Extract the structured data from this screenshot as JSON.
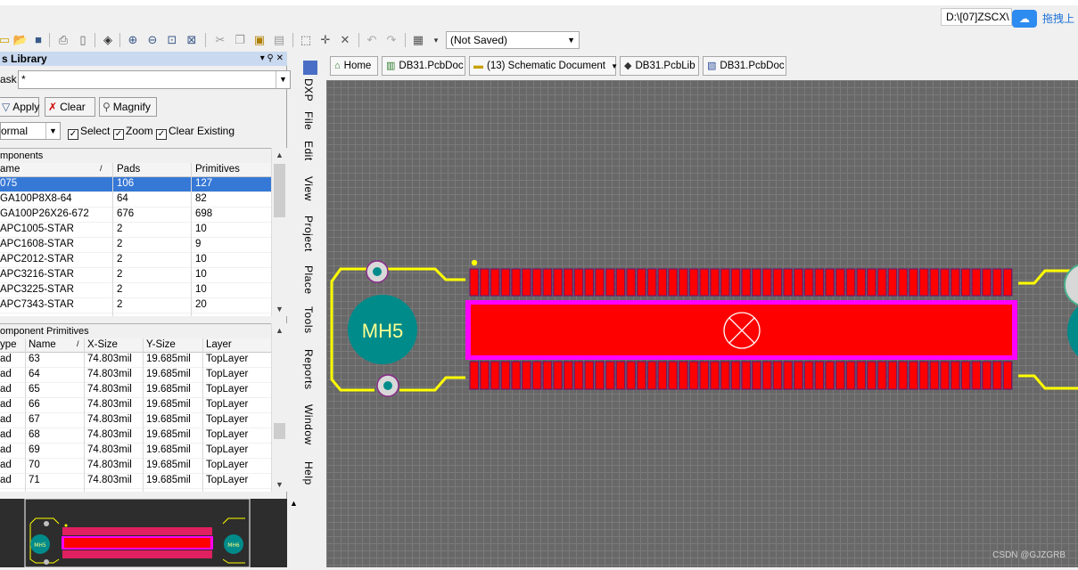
{
  "topbar": {
    "path_text": "D:\\[07]ZSCX\\",
    "cloud_label": "拖拽上"
  },
  "toolbar": {
    "not_saved": "(Not Saved)"
  },
  "library_panel": {
    "title": "s Library",
    "mask_label": "ask",
    "mask_value": "*",
    "apply_label": "Apply",
    "clear_label": "Clear",
    "magnify_label": "Magnify",
    "mode_value": "ormal",
    "select_label": "Select",
    "zoom_label": "Zoom",
    "clear_existing_label": "Clear Existing"
  },
  "components": {
    "section_title": "mponents",
    "columns": [
      "ame",
      "Pads",
      "Primitives"
    ],
    "rows": [
      {
        "name": "075",
        "pads": "106",
        "primitives": "127"
      },
      {
        "name": "GA100P8X8-64",
        "pads": "64",
        "primitives": "82"
      },
      {
        "name": "GA100P26X26-672",
        "pads": "676",
        "primitives": "698"
      },
      {
        "name": "APC1005-STAR",
        "pads": "2",
        "primitives": "10"
      },
      {
        "name": "APC1608-STAR",
        "pads": "2",
        "primitives": "9"
      },
      {
        "name": "APC2012-STAR",
        "pads": "2",
        "primitives": "10"
      },
      {
        "name": "APC3216-STAR",
        "pads": "2",
        "primitives": "10"
      },
      {
        "name": "APC3225-STAR",
        "pads": "2",
        "primitives": "10"
      },
      {
        "name": "APC7343-STAR",
        "pads": "2",
        "primitives": "20"
      }
    ]
  },
  "primitives": {
    "section_title": "omponent Primitives",
    "columns": [
      "ype",
      "Name",
      "X-Size",
      "Y-Size",
      "Layer"
    ],
    "rows": [
      {
        "type": "ad",
        "name": "63",
        "xsize": "74.803mil",
        "ysize": "19.685mil",
        "layer": "TopLayer"
      },
      {
        "type": "ad",
        "name": "64",
        "xsize": "74.803mil",
        "ysize": "19.685mil",
        "layer": "TopLayer"
      },
      {
        "type": "ad",
        "name": "65",
        "xsize": "74.803mil",
        "ysize": "19.685mil",
        "layer": "TopLayer"
      },
      {
        "type": "ad",
        "name": "66",
        "xsize": "74.803mil",
        "ysize": "19.685mil",
        "layer": "TopLayer"
      },
      {
        "type": "ad",
        "name": "67",
        "xsize": "74.803mil",
        "ysize": "19.685mil",
        "layer": "TopLayer"
      },
      {
        "type": "ad",
        "name": "68",
        "xsize": "74.803mil",
        "ysize": "19.685mil",
        "layer": "TopLayer"
      },
      {
        "type": "ad",
        "name": "69",
        "xsize": "74.803mil",
        "ysize": "19.685mil",
        "layer": "TopLayer"
      },
      {
        "type": "ad",
        "name": "70",
        "xsize": "74.803mil",
        "ysize": "19.685mil",
        "layer": "TopLayer"
      },
      {
        "type": "ad",
        "name": "71",
        "xsize": "74.803mil",
        "ysize": "19.685mil",
        "layer": "TopLayer"
      }
    ]
  },
  "menu_strip": [
    "DXP",
    "File",
    "Edit",
    "View",
    "Project",
    "Place",
    "Tools",
    "Reports",
    "Window",
    "Help"
  ],
  "tabs": [
    {
      "label": "Home",
      "icon": "home-icon"
    },
    {
      "label": "DB31.PcbDoc",
      "icon": "pcb-icon"
    },
    {
      "label": "(13) Schematic Document",
      "icon": "folder-icon"
    },
    {
      "label": "DB31.PcbLib",
      "icon": "pcblib-icon"
    },
    {
      "label": "DB31.PcbDoc",
      "icon": "pcbdoc-icon"
    }
  ],
  "canvas": {
    "hole_label": "MH5",
    "pad_count_per_row": 52
  },
  "watermark": "CSDN @GJZGRB",
  "colors": {
    "canvas_bg": "#686868",
    "pad_red": "#ff0000",
    "outline_yellow": "#ffff00",
    "hole_teal": "#008b8b",
    "keepout_magenta": "#ff00ff",
    "selection_blue": "#3678d6"
  }
}
